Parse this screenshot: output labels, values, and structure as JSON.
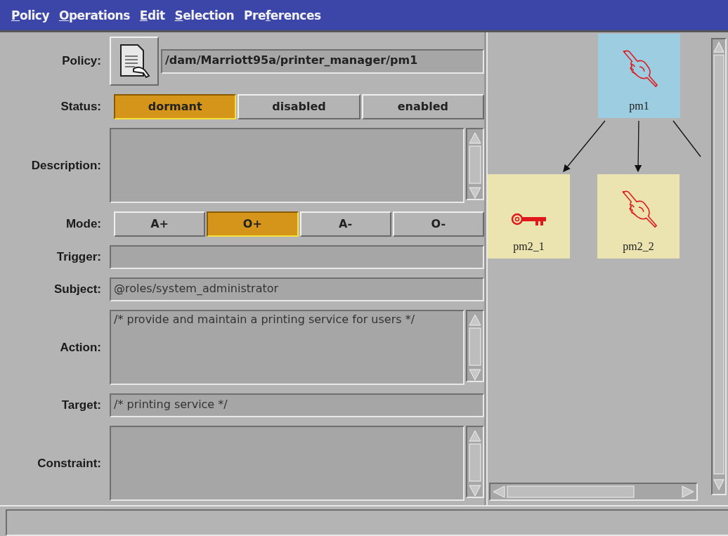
{
  "menu": [
    {
      "key": "P",
      "after": "olicy"
    },
    {
      "key": "O",
      "after": "perations"
    },
    {
      "key": "E",
      "after": "dit"
    },
    {
      "key": "S",
      "after": "election"
    },
    {
      "before": "Pre",
      "key": "f",
      "after": "erences"
    }
  ],
  "form": [
    {
      "kind": "path",
      "label": "Policy:",
      "value": "/dam/Marriott95a/printer_manager/pm1"
    },
    {
      "kind": "choice",
      "label": "Status:",
      "options": [
        {
          "label": "dormant",
          "selected": true
        },
        {
          "label": "disabled",
          "selected": false
        },
        {
          "label": "enabled",
          "selected": false
        }
      ]
    },
    {
      "kind": "area",
      "label": "Description:"
    },
    {
      "kind": "choice",
      "label": "Mode:",
      "options": [
        {
          "label": "A+",
          "selected": false
        },
        {
          "label": "O+",
          "selected": true
        },
        {
          "label": "A-",
          "selected": false
        },
        {
          "label": "O-",
          "selected": false
        }
      ]
    },
    {
      "kind": "line",
      "label": "Trigger:"
    },
    {
      "kind": "line",
      "label": "Subject:",
      "value": "@roles/system_administrator"
    },
    {
      "kind": "area",
      "label": "Action:",
      "value": "/* provide and maintain a printing service for users */"
    },
    {
      "kind": "line",
      "label": "Target:",
      "value": "/* printing service */"
    },
    {
      "kind": "area",
      "label": "Constraint:"
    }
  ],
  "diagram": {
    "nodes": [
      {
        "label": "pm1",
        "kind": "hand",
        "color": "#9dcde0",
        "more_children_offscreen": true,
        "children": [
          {
            "label": "pm2_1",
            "kind": "key",
            "color": "#ebe3b0"
          },
          {
            "label": "pm2_2",
            "kind": "hand",
            "color": "#ebe3b0"
          }
        ]
      }
    ]
  }
}
